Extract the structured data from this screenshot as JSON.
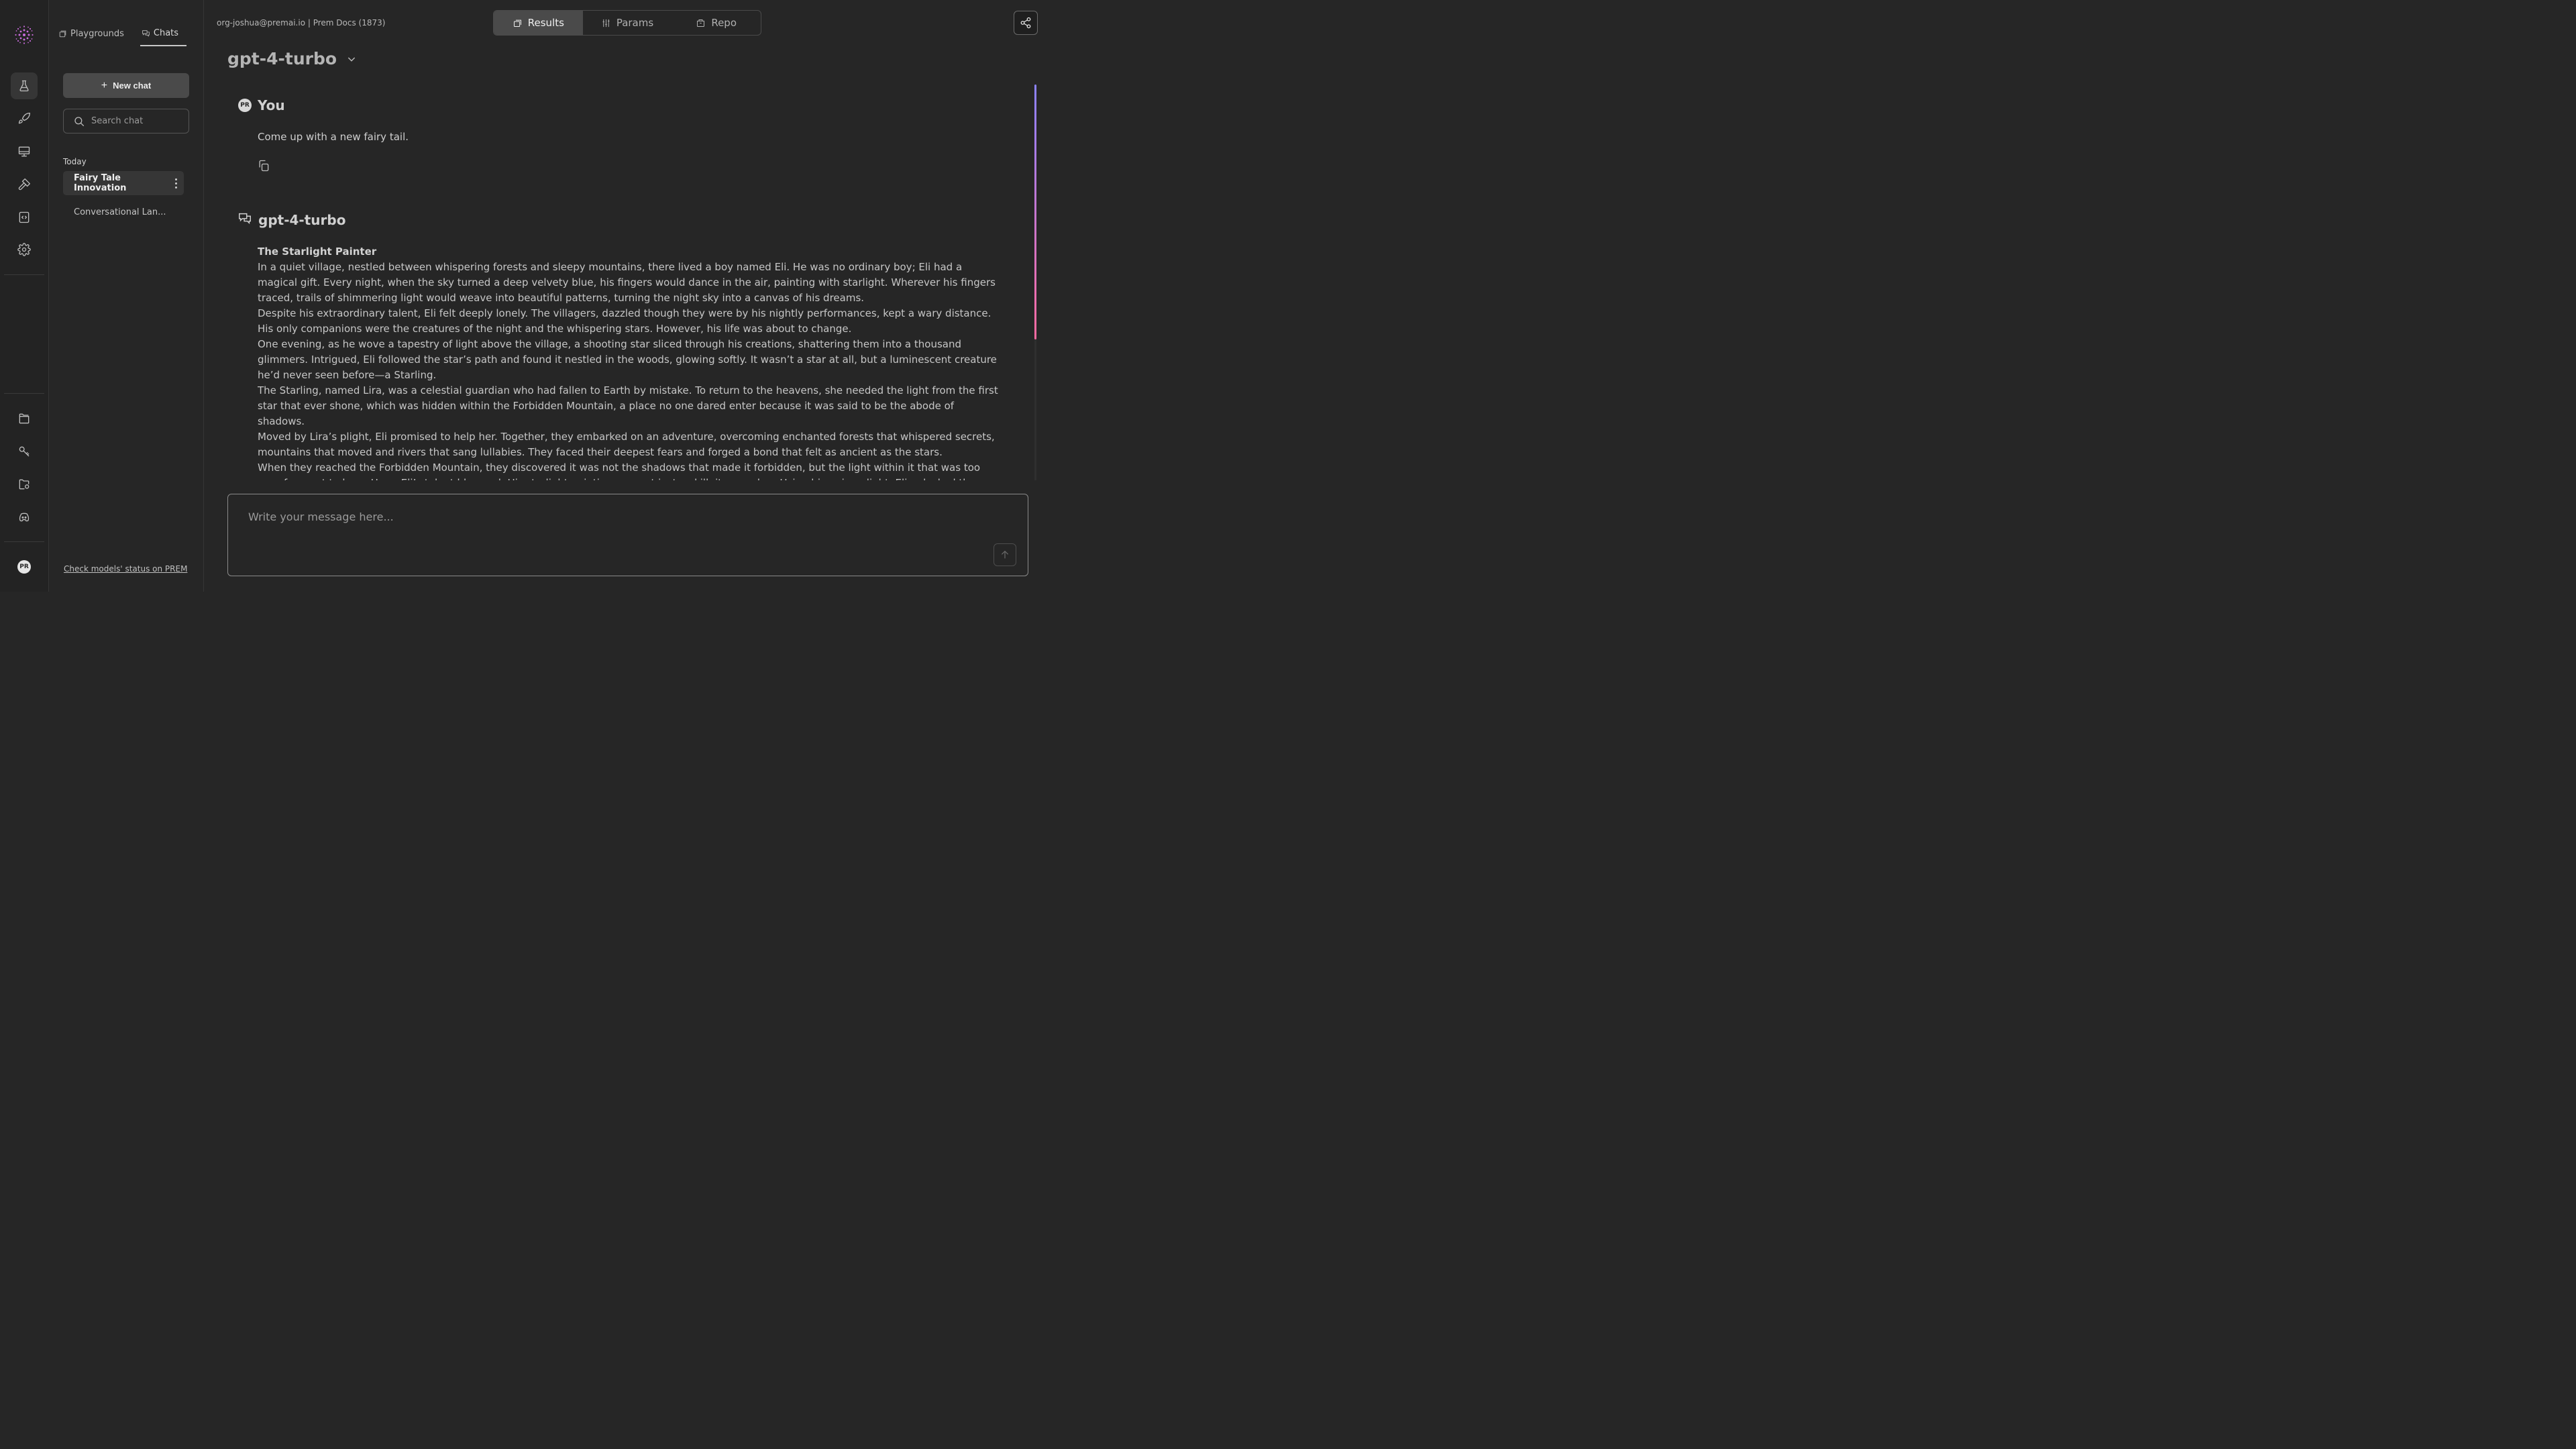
{
  "sidebar": {
    "avatar_initials": "PR"
  },
  "panel": {
    "tabs": [
      {
        "label": "Playgrounds",
        "icon": "playground-icon"
      },
      {
        "label": "Chats",
        "icon": "chat-bubbles-icon",
        "active": true
      }
    ],
    "new_chat_label": "New chat",
    "search_placeholder": "Search chat",
    "section_label": "Today",
    "conversations": [
      {
        "title": "Fairy Tale Innovation",
        "active": true
      },
      {
        "title": "Conversational Lan..."
      }
    ],
    "status_link": "Check models' status on PREM"
  },
  "header": {
    "org_info": "org-joshua@premai.io | Prem Docs (1873)",
    "tabs": [
      {
        "label": "Results",
        "active": true
      },
      {
        "label": "Params"
      },
      {
        "label": "Repo"
      }
    ]
  },
  "main": {
    "model_name": "gpt-4-turbo",
    "user_message": {
      "author": "You",
      "avatar_initials": "PR",
      "text": "Come up with a new fairy tail."
    },
    "assistant_message": {
      "author": "gpt-4-turbo",
      "story_title": "The Starlight Painter",
      "paragraphs": [
        "In a quiet village, nestled between whispering forests and sleepy mountains, there lived a boy named Eli. He was no ordinary boy; Eli had a magical gift. Every night, when the sky turned a deep velvety blue, his fingers would dance in the air, painting with starlight. Wherever his fingers traced, trails of shimmering light would weave into beautiful patterns, turning the night sky into a canvas of his dreams.",
        "Despite his extraordinary talent, Eli felt deeply lonely. The villagers, dazzled though they were by his nightly performances, kept a wary distance. His only companions were the creatures of the night and the whispering stars. However, his life was about to change.",
        "One evening, as he wove a tapestry of light above the village, a shooting star sliced through his creations, shattering them into a thousand glimmers. Intrigued, Eli followed the star’s path and found it nestled in the woods, glowing softly. It wasn’t a star at all, but a luminescent creature he’d never seen before—a Starling.",
        "The Starling, named Lira, was a celestial guardian who had fallen to Earth by mistake. To return to the heavens, she needed the light from the first star that ever shone, which was hidden within the Forbidden Mountain, a place no one dared enter because it was said to be the abode of shadows.",
        "Moved by Lira’s plight, Eli promised to help her. Together, they embarked on an adventure, overcoming enchanted forests that whispered secrets, mountains that moved and rivers that sang lullabies. They faced their deepest fears and forged a bond that felt as ancient as the stars.",
        "When they reached the Forbidden Mountain, they discovered it was not the shadows that made it forbidden, but the light within it that was too pure for most to bear. Here, Eli’s talent bloomed. His starlight painting was not just a skill; it was a key. Using his unique light, Eli unlocked the heart of the mountain, revealing the first star’s light."
      ]
    },
    "composer_placeholder": "Write your message here..."
  },
  "colors": {
    "background": "#262626",
    "rail": "#232323",
    "active_tab": "#4a4a4a",
    "scroll_gradient_top": "#8b82ff",
    "scroll_gradient_bottom": "#ff6aa0"
  }
}
